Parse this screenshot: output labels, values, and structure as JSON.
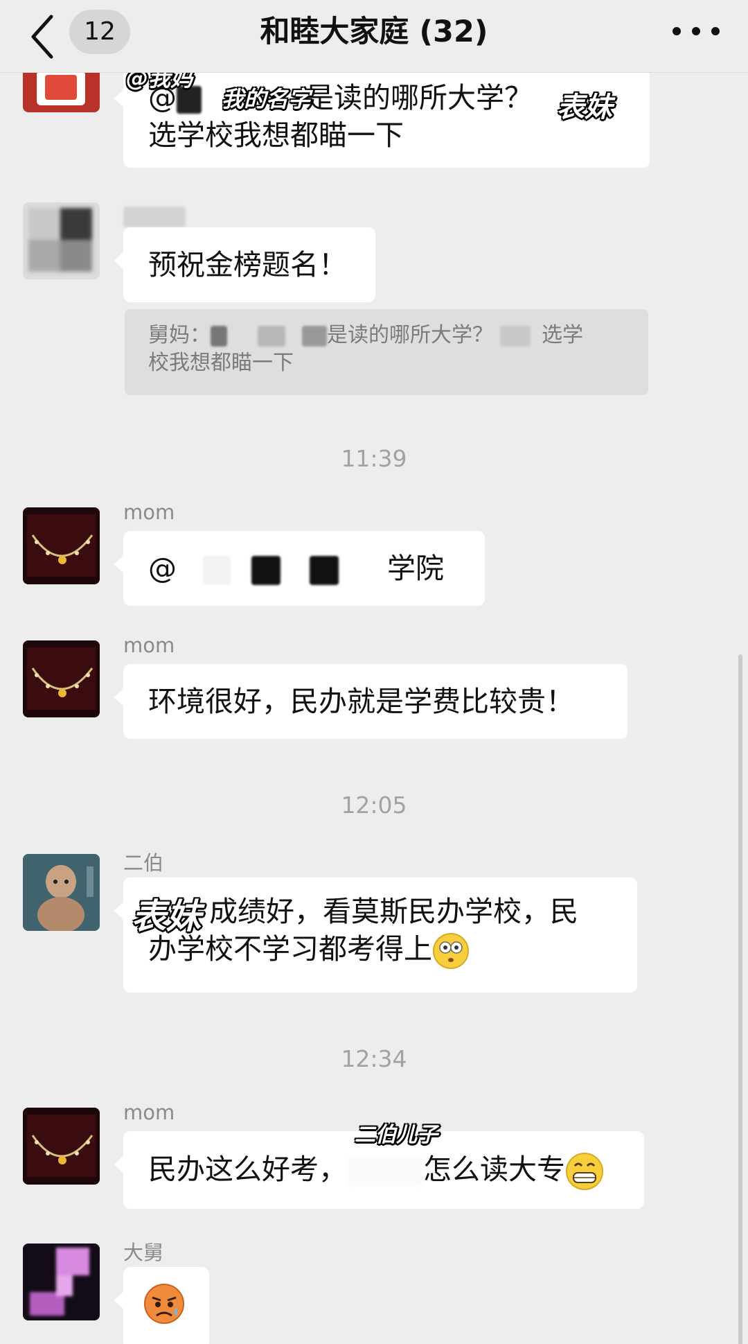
{
  "header": {
    "unread_count": "12",
    "title": "和睦大家庭 (32)"
  },
  "messages": {
    "m1": {
      "line1_pre": "@",
      "line1_post": "是读的哪所大学？",
      "line2": "选学校我想都瞄一下"
    },
    "m2": {
      "text": "预祝金榜题名！",
      "quote_label": "舅妈：",
      "quote_part1": "是读的哪所大学？",
      "quote_part2": "选学",
      "quote_line2": "校我想都瞄一下"
    },
    "time1": "11:39",
    "m3": {
      "sender": "mom",
      "pre": "@",
      "post": "学院"
    },
    "m4": {
      "sender": "mom",
      "text": "环境很好，民办就是学费比较贵！"
    },
    "time2": "12:05",
    "m5": {
      "sender": "二伯",
      "line1": "成绩好，看莫斯民办学校，民",
      "line2": "办学校不学习都考得上"
    },
    "time3": "12:34",
    "m6": {
      "sender": "mom",
      "pre": "民办这么好考，",
      "post": "怎么读大专"
    },
    "m7": {
      "sender": "大舅"
    }
  },
  "annotations": {
    "my_mom": "@我妈",
    "my_name": "我的名字",
    "cousin_1": "表妹",
    "cousin_2": "表妹",
    "uncle_son": "二伯儿子"
  },
  "icons": {
    "back": "chevron-left-icon",
    "more": "more-dots-icon",
    "flushed": "flushed-face-emoji",
    "grin": "grinning-face-emoji",
    "sweat": "anxious-sweat-face-emoji"
  }
}
